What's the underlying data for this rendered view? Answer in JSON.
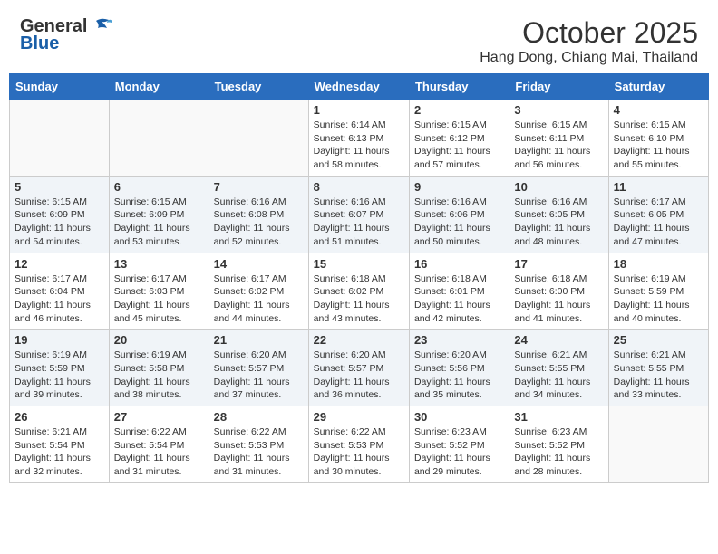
{
  "logo": {
    "general": "General",
    "blue": "Blue"
  },
  "title": "October 2025",
  "location": "Hang Dong, Chiang Mai, Thailand",
  "weekdays": [
    "Sunday",
    "Monday",
    "Tuesday",
    "Wednesday",
    "Thursday",
    "Friday",
    "Saturday"
  ],
  "weeks": [
    [
      {
        "day": "",
        "info": ""
      },
      {
        "day": "",
        "info": ""
      },
      {
        "day": "",
        "info": ""
      },
      {
        "day": "1",
        "info": "Sunrise: 6:14 AM\nSunset: 6:13 PM\nDaylight: 11 hours\nand 58 minutes."
      },
      {
        "day": "2",
        "info": "Sunrise: 6:15 AM\nSunset: 6:12 PM\nDaylight: 11 hours\nand 57 minutes."
      },
      {
        "day": "3",
        "info": "Sunrise: 6:15 AM\nSunset: 6:11 PM\nDaylight: 11 hours\nand 56 minutes."
      },
      {
        "day": "4",
        "info": "Sunrise: 6:15 AM\nSunset: 6:10 PM\nDaylight: 11 hours\nand 55 minutes."
      }
    ],
    [
      {
        "day": "5",
        "info": "Sunrise: 6:15 AM\nSunset: 6:09 PM\nDaylight: 11 hours\nand 54 minutes."
      },
      {
        "day": "6",
        "info": "Sunrise: 6:15 AM\nSunset: 6:09 PM\nDaylight: 11 hours\nand 53 minutes."
      },
      {
        "day": "7",
        "info": "Sunrise: 6:16 AM\nSunset: 6:08 PM\nDaylight: 11 hours\nand 52 minutes."
      },
      {
        "day": "8",
        "info": "Sunrise: 6:16 AM\nSunset: 6:07 PM\nDaylight: 11 hours\nand 51 minutes."
      },
      {
        "day": "9",
        "info": "Sunrise: 6:16 AM\nSunset: 6:06 PM\nDaylight: 11 hours\nand 50 minutes."
      },
      {
        "day": "10",
        "info": "Sunrise: 6:16 AM\nSunset: 6:05 PM\nDaylight: 11 hours\nand 48 minutes."
      },
      {
        "day": "11",
        "info": "Sunrise: 6:17 AM\nSunset: 6:05 PM\nDaylight: 11 hours\nand 47 minutes."
      }
    ],
    [
      {
        "day": "12",
        "info": "Sunrise: 6:17 AM\nSunset: 6:04 PM\nDaylight: 11 hours\nand 46 minutes."
      },
      {
        "day": "13",
        "info": "Sunrise: 6:17 AM\nSunset: 6:03 PM\nDaylight: 11 hours\nand 45 minutes."
      },
      {
        "day": "14",
        "info": "Sunrise: 6:17 AM\nSunset: 6:02 PM\nDaylight: 11 hours\nand 44 minutes."
      },
      {
        "day": "15",
        "info": "Sunrise: 6:18 AM\nSunset: 6:02 PM\nDaylight: 11 hours\nand 43 minutes."
      },
      {
        "day": "16",
        "info": "Sunrise: 6:18 AM\nSunset: 6:01 PM\nDaylight: 11 hours\nand 42 minutes."
      },
      {
        "day": "17",
        "info": "Sunrise: 6:18 AM\nSunset: 6:00 PM\nDaylight: 11 hours\nand 41 minutes."
      },
      {
        "day": "18",
        "info": "Sunrise: 6:19 AM\nSunset: 5:59 PM\nDaylight: 11 hours\nand 40 minutes."
      }
    ],
    [
      {
        "day": "19",
        "info": "Sunrise: 6:19 AM\nSunset: 5:59 PM\nDaylight: 11 hours\nand 39 minutes."
      },
      {
        "day": "20",
        "info": "Sunrise: 6:19 AM\nSunset: 5:58 PM\nDaylight: 11 hours\nand 38 minutes."
      },
      {
        "day": "21",
        "info": "Sunrise: 6:20 AM\nSunset: 5:57 PM\nDaylight: 11 hours\nand 37 minutes."
      },
      {
        "day": "22",
        "info": "Sunrise: 6:20 AM\nSunset: 5:57 PM\nDaylight: 11 hours\nand 36 minutes."
      },
      {
        "day": "23",
        "info": "Sunrise: 6:20 AM\nSunset: 5:56 PM\nDaylight: 11 hours\nand 35 minutes."
      },
      {
        "day": "24",
        "info": "Sunrise: 6:21 AM\nSunset: 5:55 PM\nDaylight: 11 hours\nand 34 minutes."
      },
      {
        "day": "25",
        "info": "Sunrise: 6:21 AM\nSunset: 5:55 PM\nDaylight: 11 hours\nand 33 minutes."
      }
    ],
    [
      {
        "day": "26",
        "info": "Sunrise: 6:21 AM\nSunset: 5:54 PM\nDaylight: 11 hours\nand 32 minutes."
      },
      {
        "day": "27",
        "info": "Sunrise: 6:22 AM\nSunset: 5:54 PM\nDaylight: 11 hours\nand 31 minutes."
      },
      {
        "day": "28",
        "info": "Sunrise: 6:22 AM\nSunset: 5:53 PM\nDaylight: 11 hours\nand 31 minutes."
      },
      {
        "day": "29",
        "info": "Sunrise: 6:22 AM\nSunset: 5:53 PM\nDaylight: 11 hours\nand 30 minutes."
      },
      {
        "day": "30",
        "info": "Sunrise: 6:23 AM\nSunset: 5:52 PM\nDaylight: 11 hours\nand 29 minutes."
      },
      {
        "day": "31",
        "info": "Sunrise: 6:23 AM\nSunset: 5:52 PM\nDaylight: 11 hours\nand 28 minutes."
      },
      {
        "day": "",
        "info": ""
      }
    ]
  ]
}
